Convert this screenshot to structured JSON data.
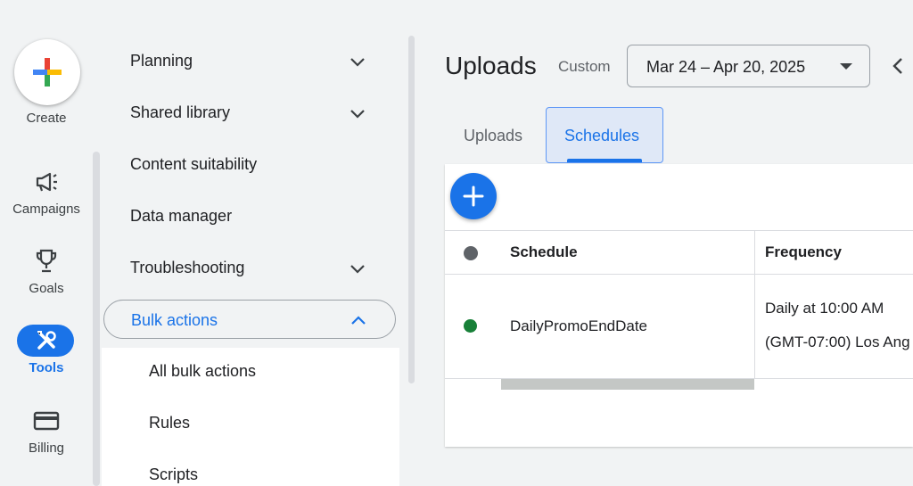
{
  "nav_rail": {
    "create_label": "Create",
    "items": [
      {
        "label": "Campaigns",
        "icon": "megaphone-icon"
      },
      {
        "label": "Goals",
        "icon": "trophy-icon"
      },
      {
        "label": "Tools",
        "icon": "tools-icon",
        "active": true
      },
      {
        "label": "Billing",
        "icon": "credit-card-icon"
      }
    ]
  },
  "tools_menu": {
    "items": [
      {
        "label": "Planning",
        "expandable": true
      },
      {
        "label": "Shared library",
        "expandable": true
      },
      {
        "label": "Content suitability",
        "expandable": false
      },
      {
        "label": "Data manager",
        "expandable": false
      },
      {
        "label": "Troubleshooting",
        "expandable": true
      },
      {
        "label": "Bulk actions",
        "expandable": true,
        "expanded": true
      }
    ],
    "bulk_actions_children": [
      "All bulk actions",
      "Rules",
      "Scripts"
    ]
  },
  "header": {
    "title": "Uploads",
    "date_range_type": "Custom",
    "date_range": "Mar 24 – Apr 20, 2025"
  },
  "tabs": [
    {
      "label": "Uploads",
      "selected": false
    },
    {
      "label": "Schedules",
      "selected": true
    }
  ],
  "table": {
    "columns": [
      "Schedule",
      "Frequency"
    ],
    "rows": [
      {
        "status": "enabled",
        "schedule": "DailyPromoEndDate",
        "frequency_line1": "Daily at 10:00 AM",
        "frequency_line2": "(GMT-07:00) Los Ang"
      }
    ]
  },
  "colors": {
    "accent": "#1a73e8",
    "status_green": "#188038",
    "background": "#f1f3f4"
  }
}
